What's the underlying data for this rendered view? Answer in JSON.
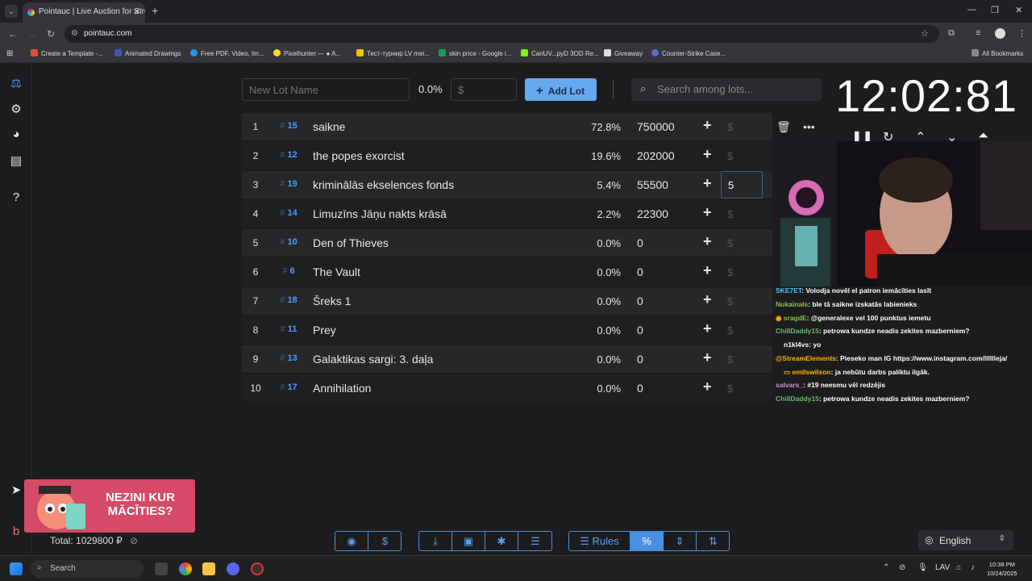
{
  "browser": {
    "tab_title": "Pointauc | Live Auction for Streamers",
    "url": "pointauc.com",
    "bookmarks": [
      "Create a Template -...",
      "Animated Drawings",
      "Free PDF, Video, Im...",
      "Pixelhunter — ● A...",
      "Тест-турнир LV mei...",
      "skin price - Google i...",
      "CanUV...pyD 3OD Re...",
      "Giveaway",
      "Counter-Strike Case..."
    ],
    "all_bookmarks": "All Bookmarks"
  },
  "toolbar": {
    "new_lot_placeholder": "New Lot Name",
    "percent": "0.0%",
    "amount_placeholder": "$",
    "add_lot_label": "Add Lot",
    "search_placeholder": "Search among lots..."
  },
  "timer": "12:02:81",
  "lots": [
    {
      "idx": "1",
      "id": "15",
      "name": "saikne",
      "pct": "72.8%",
      "amount": "750000"
    },
    {
      "idx": "2",
      "id": "12",
      "name": "the popes exorcist",
      "pct": "19.6%",
      "amount": "202000"
    },
    {
      "idx": "3",
      "id": "19",
      "name": "kriminālās ekselences fonds",
      "pct": "5.4%",
      "amount": "55500",
      "edit": "5"
    },
    {
      "idx": "4",
      "id": "14",
      "name": "Limuzīns Jāņu nakts krāsā",
      "pct": "2.2%",
      "amount": "22300"
    },
    {
      "idx": "5",
      "id": "10",
      "name": "Den of Thieves",
      "pct": "0.0%",
      "amount": "0"
    },
    {
      "idx": "6",
      "id": "6",
      "name": "The Vault",
      "pct": "0.0%",
      "amount": "0"
    },
    {
      "idx": "7",
      "id": "18",
      "name": "Šreks 1",
      "pct": "0.0%",
      "amount": "0"
    },
    {
      "idx": "8",
      "id": "11",
      "name": "Prey",
      "pct": "0.0%",
      "amount": "0"
    },
    {
      "idx": "9",
      "id": "13",
      "name": "Galaktikas sargi: 3. daļa",
      "pct": "0.0%",
      "amount": "0"
    },
    {
      "idx": "10",
      "id": "17",
      "name": "Annihilation",
      "pct": "0.0%",
      "amount": "0"
    }
  ],
  "chat": [
    {
      "user": "SKE7ET",
      "color": "#4fc3f7",
      "text": ": Volodja novēl el patron iemācīties lasīt"
    },
    {
      "user": "Nukainals",
      "color": "#8bc34a",
      "text": ": ble tā saikne izskatās labienieks"
    },
    {
      "user": "sragdE",
      "color": "#8bc34a",
      "text": ": @generalexe vel 100 punktus iemetu"
    },
    {
      "user": "ChillDaddy15",
      "color": "#66bb6a",
      "text": ": petrowa kundze neadis zekites mazberniem?"
    },
    {
      "user": "n1kl4vs",
      "color": "#ce93d8",
      "text": ": yo"
    },
    {
      "user": "@StreamElements",
      "color": "#ffb300",
      "text": ": Pieseko man IG https://www.instagram.com/lllllleja/"
    },
    {
      "user": "emilswilson",
      "color": "#ffb300",
      "text": ": ja nebūtu darbs paliktu ilgāk."
    },
    {
      "user": "salvars_",
      "color": "#ce93d8",
      "text": ": #19 neesmu vēl redzējis"
    },
    {
      "user": "ChillDaddy15",
      "color": "#66bb6a",
      "text": ": petrowa kundze neadis zekites mazberniem?"
    }
  ],
  "promo": "NEZINI KUR MĀCĪTIES?",
  "total": "Total: 1029800 ₽",
  "footer_buttons": {
    "rules": "Rules",
    "percent": "%"
  },
  "language": "English",
  "taskbar": {
    "search": "Search",
    "lang": "LAV",
    "time": "10:38 PM",
    "date": "10/24/2025"
  }
}
